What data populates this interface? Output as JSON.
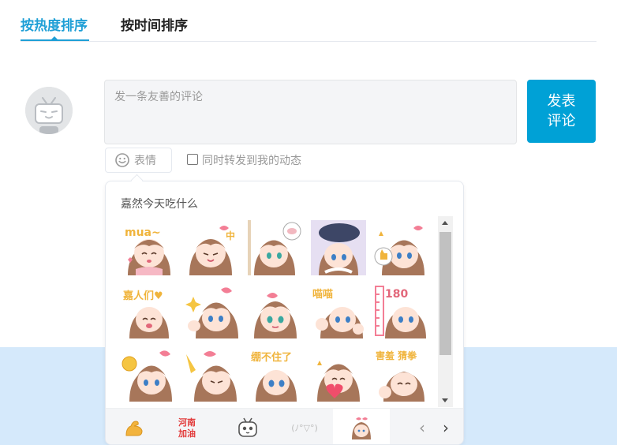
{
  "tabs": {
    "hot": "按热度排序",
    "time": "按时间排序"
  },
  "comment": {
    "placeholder": "发一条友善的评论",
    "submit_line1": "发表",
    "submit_line2": "评论"
  },
  "emoji_button": {
    "label": "表情",
    "icon": "smile-icon"
  },
  "forward": {
    "label": "同时转发到我的动态",
    "checked": false
  },
  "emoji_panel": {
    "title": "嘉然今天吃什么",
    "sticker_captions": [
      "mua~",
      "中"
    ],
    "sticker_captions_2": [
      "嘉人们♥",
      "喵喵",
      "180"
    ],
    "sticker_captions_3": [
      "绷不住了",
      "害羞 猜拳"
    ],
    "package_icons": [
      "flex-arm-icon",
      "henan-jiayou-icon",
      "tv-mascot-icon",
      "kaomoji-icon",
      "diana-icon"
    ],
    "package_text": {
      "henan": "河南加油",
      "kaomoji": "(ﾉ°▽°)"
    },
    "nav_prev": "‹",
    "nav_next": "›"
  },
  "colors": {
    "accent": "#00a1d6",
    "active_tab": "#1e9fd6",
    "band": "#d5e9fb"
  }
}
